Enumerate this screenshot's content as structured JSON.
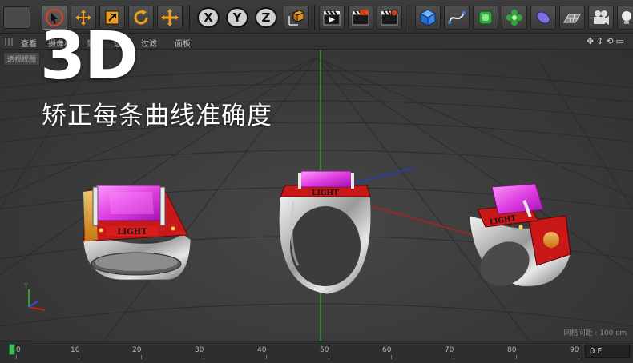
{
  "toolbar": {
    "axis_buttons": [
      "X",
      "Y",
      "Z"
    ]
  },
  "menubar": {
    "items": [
      "查看",
      "摄像机",
      "显示",
      "选项",
      "过滤",
      "面板"
    ]
  },
  "viewport": {
    "label": "透视视图",
    "grid_spacing": "网格间距 : 100 cm"
  },
  "overlay": {
    "title": "3D",
    "subtitle": "矫正每条曲线准确度"
  },
  "rings": {
    "engraving": "LIGHT"
  },
  "timeline": {
    "ticks": [
      "0",
      "10",
      "20",
      "30",
      "40",
      "50",
      "60",
      "70",
      "80",
      "90"
    ],
    "current_frame": "0 F"
  },
  "colors": {
    "gem": "#e040e0",
    "enamel": "#c81818",
    "silver": "#c8c8c8",
    "playhead": "#3fbf5a",
    "axis_green": "#2fa02f",
    "axis_red": "#b02020",
    "axis_blue": "#2040c0"
  }
}
